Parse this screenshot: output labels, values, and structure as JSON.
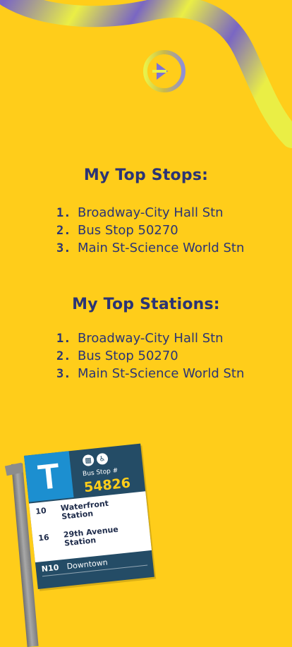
{
  "colors": {
    "background": "#FFCD1A",
    "text": "#2B3475",
    "swoosh_blue": "#6B5BD6",
    "swoosh_yellow": "#E8F24A"
  },
  "top_stops": {
    "title": "My Top Stops:",
    "items": [
      {
        "rank": "1.",
        "name": "Broadway-City Hall Stn"
      },
      {
        "rank": "2.",
        "name": "Bus Stop 50270"
      },
      {
        "rank": "3.",
        "name": "Main St-Science World Stn"
      }
    ]
  },
  "top_stations": {
    "title": "My Top Stations:",
    "items": [
      {
        "rank": "1.",
        "name": "Broadway-City Hall Stn"
      },
      {
        "rank": "2.",
        "name": "Bus Stop 50270"
      },
      {
        "rank": "3.",
        "name": "Main St-Science World Stn"
      }
    ]
  },
  "sign": {
    "letter": "T",
    "stop_label": "Bus Stop #",
    "stop_number": "54826",
    "routes": [
      {
        "number": "10",
        "destination": "Waterfront Station"
      },
      {
        "number": "16",
        "destination": "29th Avenue Station"
      }
    ],
    "night_route": {
      "number": "N10",
      "destination": "Downtown"
    }
  }
}
